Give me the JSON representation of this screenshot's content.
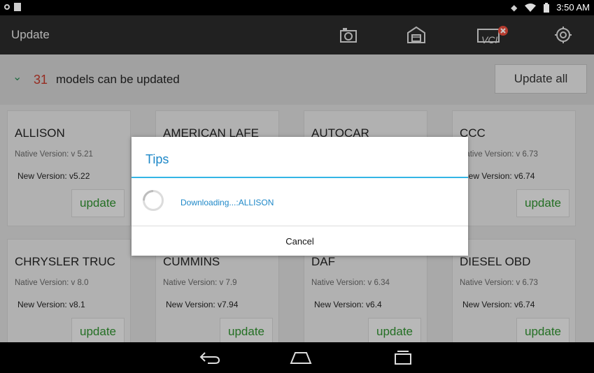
{
  "status_bar": {
    "time": "3:50 AM"
  },
  "app_bar": {
    "title": "Update",
    "icons": [
      "camera-icon",
      "garage-icon",
      "vci-icon",
      "settings-icon"
    ],
    "vci_label": "VCI"
  },
  "summary": {
    "count": "31",
    "text": "models can be updated",
    "update_all_label": "Update all"
  },
  "cards": [
    {
      "name": "ALLISON",
      "native": "Native Version:  v 5.21",
      "new": "New Version: v5.22",
      "button": "update"
    },
    {
      "name": "AMERICAN LAFE",
      "native": "",
      "new": "",
      "button": ""
    },
    {
      "name": "AUTOCAR",
      "native": "",
      "new": "",
      "button": ""
    },
    {
      "name": "CCC",
      "native": "Native Version:  v 6.73",
      "new": "New Version: v6.74",
      "button": "update"
    },
    {
      "name": "CHRYSLER TRUC",
      "native": "Native Version:  v 8.0",
      "new": "New Version: v8.1",
      "button": "update"
    },
    {
      "name": "CUMMINS",
      "native": "Native Version:  v 7.9",
      "new": "New Version: v7.94",
      "button": "update"
    },
    {
      "name": "DAF",
      "native": "Native Version:  v 6.34",
      "new": "New Version: v6.4",
      "button": "update"
    },
    {
      "name": "DIESEL OBD",
      "native": "Native Version:  v 6.73",
      "new": "New Version: v6.74",
      "button": "update"
    }
  ],
  "dialog": {
    "title": "Tips",
    "message": "Downloading...:ALLISON",
    "cancel_label": "Cancel"
  },
  "colors": {
    "accent": "#33b5e5",
    "count_red": "#c0392b",
    "update_green": "#2f8f2f"
  }
}
